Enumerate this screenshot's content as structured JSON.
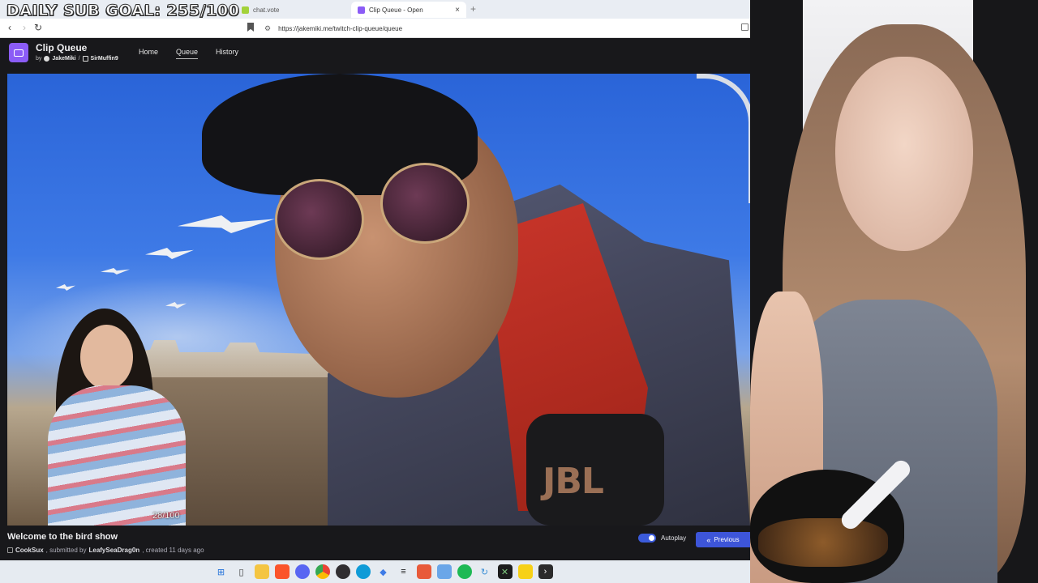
{
  "overlay": {
    "goal_text": "DAILY SUB GOAL: 255/100"
  },
  "browser": {
    "tabs": [
      {
        "label": "chat.vote",
        "favicon_color": "#a3d23a"
      },
      {
        "label": "Clip Queue - Open",
        "favicon_color": "#8b5cf6"
      }
    ],
    "url": "https://jakemiki.me/twitch-clip-queue/queue"
  },
  "app": {
    "title": "Clip Queue",
    "by": "by",
    "author1": "JakeMiki",
    "separator": "/",
    "author2": "SirMuffin9",
    "nav": {
      "home": "Home",
      "queue": "Queue",
      "history": "History",
      "active": "Queue"
    },
    "accent": "#8b5cf6"
  },
  "player": {
    "counter": "28/100"
  },
  "clip": {
    "title": "Welcome to the bird show",
    "channel": "CookSux",
    "submitted_prefix": ", submitted by",
    "submitter": "LeafySeaDrag0n",
    "created": ", created 11 days ago"
  },
  "controls": {
    "autoplay_label": "Autoplay",
    "autoplay_on": true,
    "previous_label": "Previous",
    "button_color": "#3d55d9"
  },
  "taskbar": {
    "icons": [
      "windows-start-icon",
      "search-icon",
      "file-explorer-icon",
      "brave-icon",
      "discord-icon",
      "chrome-icon",
      "obs-icon",
      "edge-icon",
      "vpn-icon",
      "epic-icon",
      "brave-alt-icon",
      "notepad-icon",
      "spotify-icon",
      "refresh-app-icon",
      "terminal-x-icon",
      "yellow-app-icon",
      "terminal-icon"
    ]
  }
}
